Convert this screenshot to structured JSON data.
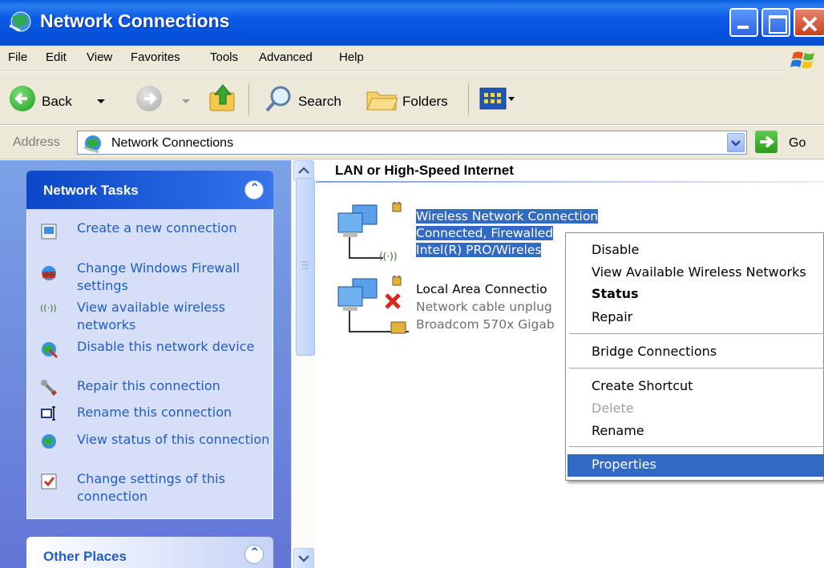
{
  "window": {
    "title": "Network Connections"
  },
  "menu": [
    "File",
    "Edit",
    "View",
    "Favorites",
    "Tools",
    "Advanced",
    "Help"
  ],
  "toolbar": {
    "back": "Back",
    "search": "Search",
    "folders": "Folders"
  },
  "address": {
    "label": "Address",
    "value": "Network Connections",
    "go": "Go"
  },
  "tasks": {
    "header": "Network Tasks",
    "items": [
      {
        "label": "Create a new connection",
        "icon": "new-connection-icon"
      },
      {
        "label": "Change Windows Firewall settings",
        "icon": "firewall-icon"
      },
      {
        "label": "View available wireless networks",
        "icon": "wireless-icon"
      },
      {
        "label": "Disable this network device",
        "icon": "disable-device-icon"
      },
      {
        "label": "Repair this connection",
        "icon": "repair-icon"
      },
      {
        "label": "Rename this connection",
        "icon": "rename-icon"
      },
      {
        "label": "View status of this connection",
        "icon": "status-icon"
      },
      {
        "label": "Change settings of this connection",
        "icon": "settings-icon"
      }
    ],
    "other_header": "Other Places"
  },
  "main": {
    "group_title": "LAN or High-Speed Internet",
    "connections": [
      {
        "name": "Wireless Network Connection",
        "status": "Connected, Firewalled",
        "device": "Intel(R) PRO/Wireles",
        "selected": true
      },
      {
        "name": "Local Area Connectio",
        "status": "Network cable unplug",
        "device": "Broadcom 570x Gigab",
        "selected": false
      }
    ]
  },
  "context_menu": {
    "items": [
      {
        "label": "Disable",
        "bold": false,
        "disabled": false
      },
      {
        "label": "View Available Wireless Networks",
        "bold": false,
        "disabled": false
      },
      {
        "label": "Status",
        "bold": true,
        "disabled": false
      },
      {
        "label": "Repair",
        "bold": false,
        "disabled": false
      },
      {
        "label": "Bridge Connections",
        "bold": false,
        "disabled": false
      },
      {
        "label": "Create Shortcut",
        "bold": false,
        "disabled": false
      },
      {
        "label": "Delete",
        "bold": false,
        "disabled": true
      },
      {
        "label": "Rename",
        "bold": false,
        "disabled": false
      },
      {
        "label": "Properties",
        "bold": false,
        "disabled": false,
        "highlighted": true
      }
    ]
  },
  "colors": {
    "title_bar": "#0b5ae6",
    "selection": "#316ac5",
    "task_link": "#215dc6",
    "task_pane": "#7ba2e7"
  }
}
